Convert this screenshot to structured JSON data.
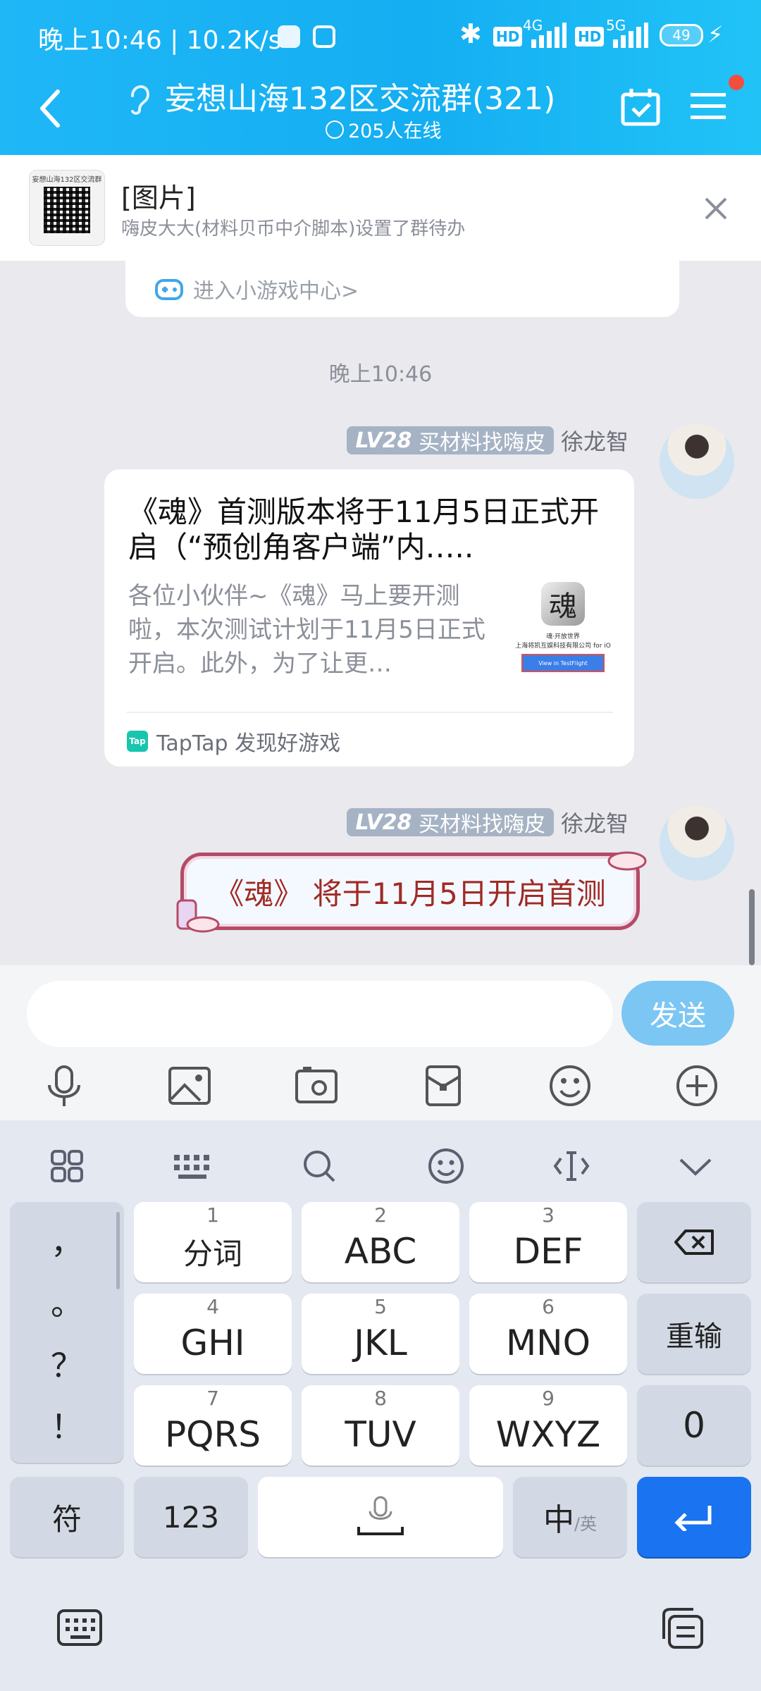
{
  "status_bar": {
    "time_speed": "晚上10:46 | 10.2K/s",
    "net1": "4G",
    "net2": "5G",
    "hd": "HD",
    "battery": "49"
  },
  "header": {
    "title": "妄想山海132区交流群(321)",
    "online": "205人在线"
  },
  "pinned": {
    "title": "[图片]",
    "subtitle": "嗨皮大大(材料贝币中介脚本)设置了群待办",
    "thumb_caption": "妄想山海132区交流群"
  },
  "game_center_link": "进入小游戏中心>",
  "timestamp": "晚上10:46",
  "messages": [
    {
      "level": "LV28",
      "title_tag": "买材料找嗨皮",
      "sender": "徐龙智",
      "card_title": "《魂》首测版本将于11月5日正式开启（“预创角客户端”内…..",
      "card_desc": "各位小伙伴~《魂》马上要开测啦，本次测试计划于11月5日正式开启。此外，为了让更…",
      "card_thumb_glyph": "魂",
      "card_thumb_text1": "魂·开放世界",
      "card_thumb_text2": "上海将凯互娱科技有限公司 for iO",
      "card_thumb_btn": "View in TestFlight",
      "card_source": "TapTap 发现好游戏",
      "card_source_icon": "Tap"
    },
    {
      "level": "LV28",
      "title_tag": "买材料找嗨皮",
      "sender": "徐龙智",
      "bubble_text": "《魂》 将于11月5日开启首测"
    }
  ],
  "input": {
    "placeholder": "",
    "send_label": "发送"
  },
  "toolbar_icons": [
    "microphone-icon",
    "image-icon",
    "camera-icon",
    "red-packet-icon",
    "emoji-icon",
    "plus-icon"
  ],
  "keyboard": {
    "punct": [
      "，",
      "。",
      "？",
      "！"
    ],
    "keys": [
      {
        "num": "1",
        "label": "分词"
      },
      {
        "num": "2",
        "label": "ABC"
      },
      {
        "num": "3",
        "label": "DEF"
      },
      {
        "num": "4",
        "label": "GHI"
      },
      {
        "num": "5",
        "label": "JKL"
      },
      {
        "num": "6",
        "label": "MNO"
      },
      {
        "num": "7",
        "label": "PQRS"
      },
      {
        "num": "8",
        "label": "TUV"
      },
      {
        "num": "9",
        "label": "WXYZ"
      }
    ],
    "reenter": "重输",
    "zero": "0",
    "symbol": "符",
    "num123": "123",
    "lang_main": "中",
    "lang_sub": "/英"
  },
  "colors": {
    "header_blue": "#14aef2",
    "send_button": "#7cc6f3",
    "enter_key": "#1a73f0",
    "bubble_text": "#a02a25"
  }
}
